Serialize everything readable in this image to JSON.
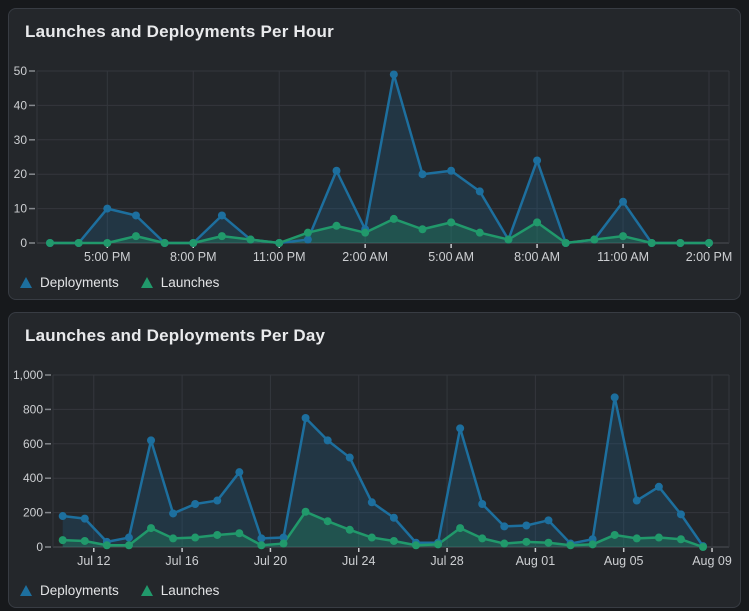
{
  "page_bg": "#17191c",
  "card": {
    "bg": "#24272b",
    "border": "#383c43"
  },
  "colors": {
    "grid": "#34373d",
    "axis_line": "#4b4f55",
    "y_tick_dash": "#85888d",
    "x_tick_dash": "#c8c9cc",
    "axis_label": "#cdcfd2",
    "title": "#e9eaec",
    "legend_text": "#e3e4e6",
    "deployments_blue": "#1d6f9e",
    "launches_green": "#21996b"
  },
  "chart_data": [
    {
      "type": "line",
      "title": "Launches and Deployments Per Hour",
      "x_unit": "hour",
      "ylim": [
        0,
        50
      ],
      "y_tick_labels": [
        "0",
        "10",
        "20",
        "30",
        "40",
        "50"
      ],
      "grid": true,
      "legend_position": "bottom-left",
      "x_ticks": [
        {
          "index": 2,
          "label": "5:00 PM"
        },
        {
          "index": 5,
          "label": "8:00 PM"
        },
        {
          "index": 8,
          "label": "11:00 PM"
        },
        {
          "index": 11,
          "label": "2:00 AM"
        },
        {
          "index": 14,
          "label": "5:00 AM"
        },
        {
          "index": 17,
          "label": "8:00 AM"
        },
        {
          "index": 20,
          "label": "11:00 AM"
        },
        {
          "index": 23,
          "label": "2:00 PM"
        }
      ],
      "series": [
        {
          "name": "Deployments",
          "color": "#1d6f9e",
          "fill": "rgba(29,111,158,0.22)",
          "values": [
            0,
            0,
            10,
            8,
            0,
            0,
            8,
            1,
            0,
            1,
            21,
            4,
            49,
            20,
            21,
            15,
            1,
            24,
            0,
            1,
            12,
            0,
            0,
            0
          ]
        },
        {
          "name": "Launches",
          "color": "#21996b",
          "fill": "rgba(33,153,107,0.30)",
          "values": [
            0,
            0,
            0,
            2,
            0,
            0,
            2,
            1,
            0,
            3,
            5,
            3,
            7,
            4,
            6,
            3,
            1,
            6,
            0,
            1,
            2,
            0,
            0,
            0
          ]
        }
      ]
    },
    {
      "type": "line",
      "title": "Launches and Deployments Per Day",
      "x_unit": "day",
      "ylim": [
        0,
        1000
      ],
      "y_tick_labels": [
        "0",
        "200",
        "400",
        "600",
        "800",
        "1,000"
      ],
      "grid": true,
      "legend_position": "bottom-left",
      "x_ticks": [
        {
          "index": 1,
          "label": "Jul 12"
        },
        {
          "index": 5,
          "label": "Jul 16"
        },
        {
          "index": 9,
          "label": "Jul 20"
        },
        {
          "index": 13,
          "label": "Jul 24"
        },
        {
          "index": 17,
          "label": "Jul 28"
        },
        {
          "index": 21,
          "label": "Aug 01"
        },
        {
          "index": 25,
          "label": "Aug 05"
        },
        {
          "index": 29,
          "label": "Aug 09"
        }
      ],
      "series": [
        {
          "name": "Deployments",
          "color": "#1d6f9e",
          "fill": "rgba(29,111,158,0.22)",
          "values": [
            180,
            165,
            30,
            55,
            620,
            195,
            250,
            270,
            435,
            50,
            55,
            750,
            620,
            520,
            260,
            170,
            25,
            25,
            690,
            250,
            120,
            125,
            155,
            20,
            45,
            870,
            270,
            350,
            190,
            5
          ]
        },
        {
          "name": "Launches",
          "color": "#21996b",
          "fill": "rgba(33,153,107,0.30)",
          "values": [
            40,
            35,
            10,
            10,
            110,
            50,
            55,
            70,
            80,
            10,
            20,
            205,
            150,
            100,
            55,
            35,
            10,
            15,
            110,
            50,
            20,
            30,
            25,
            10,
            15,
            70,
            50,
            55,
            45,
            0
          ]
        }
      ]
    }
  ]
}
